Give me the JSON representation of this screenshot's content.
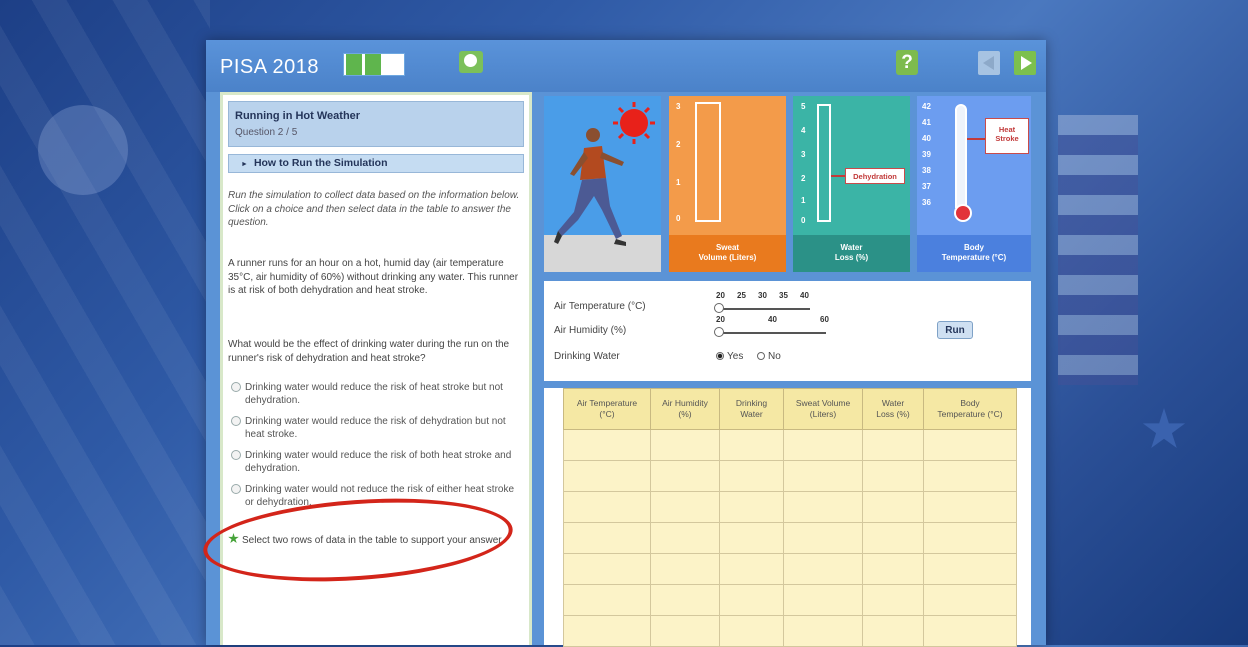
{
  "app": {
    "title": "PISA 2018",
    "help_label": "?",
    "progress_value": 0.67,
    "colors": {
      "topbar": "#4b82c9",
      "accent_green": "#7cc04e",
      "annotation_red": "#d3251a"
    }
  },
  "question": {
    "title": "Running in Hot Weather",
    "number": "Question 2 / 5",
    "howto_label": "How to Run the Simulation",
    "instructions": "Run the simulation to collect data based on the information below. Click on a choice and then select data in the table to answer the question.",
    "scenario": "A runner runs for an hour on a hot, humid day (air temperature 35°C, air humidity of 60%) without drinking any water. This runner is at risk of both dehydration and heat stroke.",
    "prompt": "What would be the effect of drinking water during the run on the runner's risk of dehydration and heat stroke?",
    "choices": [
      "Drinking water would reduce the risk of heat stroke but not dehydration.",
      "Drinking water would reduce the risk of dehydration but not heat stroke.",
      "Drinking water would reduce the risk of both heat stroke and dehydration.",
      "Drinking water would not reduce the risk of either heat stroke or dehydration."
    ],
    "select_note": "Select two rows of data in the table to support your answer."
  },
  "visual": {
    "sweat": {
      "caption_1": "Sweat",
      "caption_2": "Volume (Liters)",
      "ticks": [
        "3",
        "2",
        "1",
        "0"
      ]
    },
    "water": {
      "caption_1": "Water",
      "caption_2": "Loss (%)",
      "ticks": [
        "5",
        "4",
        "3",
        "2",
        "1",
        "0"
      ],
      "callout": "Dehydration"
    },
    "temp": {
      "caption_1": "Body",
      "caption_2": "Temperature (°C)",
      "ticks": [
        "42",
        "41",
        "40",
        "39",
        "38",
        "37",
        "36"
      ],
      "callout_1": "Heat",
      "callout_2": "Stroke"
    }
  },
  "controls": {
    "air_temp_label": "Air Temperature (°C)",
    "air_temp_ticks": [
      "20",
      "25",
      "30",
      "35",
      "40"
    ],
    "air_humidity_label": "Air Humidity (%)",
    "air_humidity_ticks": [
      "20",
      "40",
      "60"
    ],
    "drinking_label": "Drinking Water",
    "yes_label": "Yes",
    "no_label": "No",
    "drinking_selected": "Yes",
    "run_label": "Run"
  },
  "table": {
    "headers": [
      [
        "Air Temperature",
        "(°C)"
      ],
      [
        "Air Humidity",
        "(%)"
      ],
      [
        "Drinking",
        "Water"
      ],
      [
        "Sweat Volume",
        "(Liters)"
      ],
      [
        "Water",
        "Loss (%)"
      ],
      [
        "Body",
        "Temperature (°C)"
      ]
    ]
  }
}
